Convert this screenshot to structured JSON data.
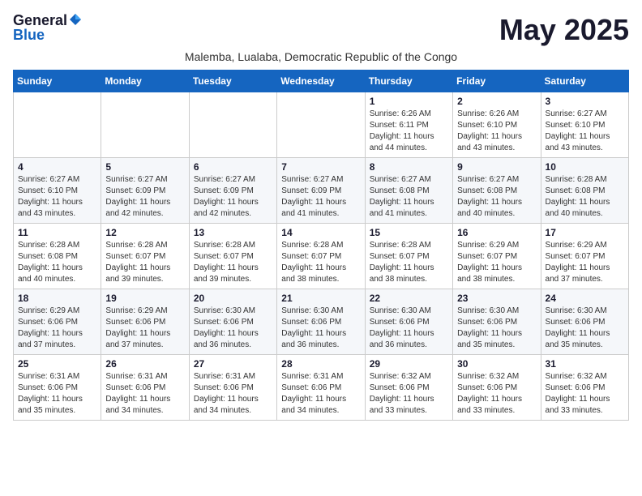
{
  "logo": {
    "general": "General",
    "blue": "Blue"
  },
  "title": "May 2025",
  "subtitle": "Malemba, Lualaba, Democratic Republic of the Congo",
  "weekdays": [
    "Sunday",
    "Monday",
    "Tuesday",
    "Wednesday",
    "Thursday",
    "Friday",
    "Saturday"
  ],
  "weeks": [
    [
      {
        "day": "",
        "info": ""
      },
      {
        "day": "",
        "info": ""
      },
      {
        "day": "",
        "info": ""
      },
      {
        "day": "",
        "info": ""
      },
      {
        "day": "1",
        "info": "Sunrise: 6:26 AM\nSunset: 6:11 PM\nDaylight: 11 hours and 44 minutes."
      },
      {
        "day": "2",
        "info": "Sunrise: 6:26 AM\nSunset: 6:10 PM\nDaylight: 11 hours and 43 minutes."
      },
      {
        "day": "3",
        "info": "Sunrise: 6:27 AM\nSunset: 6:10 PM\nDaylight: 11 hours and 43 minutes."
      }
    ],
    [
      {
        "day": "4",
        "info": "Sunrise: 6:27 AM\nSunset: 6:10 PM\nDaylight: 11 hours and 43 minutes."
      },
      {
        "day": "5",
        "info": "Sunrise: 6:27 AM\nSunset: 6:09 PM\nDaylight: 11 hours and 42 minutes."
      },
      {
        "day": "6",
        "info": "Sunrise: 6:27 AM\nSunset: 6:09 PM\nDaylight: 11 hours and 42 minutes."
      },
      {
        "day": "7",
        "info": "Sunrise: 6:27 AM\nSunset: 6:09 PM\nDaylight: 11 hours and 41 minutes."
      },
      {
        "day": "8",
        "info": "Sunrise: 6:27 AM\nSunset: 6:08 PM\nDaylight: 11 hours and 41 minutes."
      },
      {
        "day": "9",
        "info": "Sunrise: 6:27 AM\nSunset: 6:08 PM\nDaylight: 11 hours and 40 minutes."
      },
      {
        "day": "10",
        "info": "Sunrise: 6:28 AM\nSunset: 6:08 PM\nDaylight: 11 hours and 40 minutes."
      }
    ],
    [
      {
        "day": "11",
        "info": "Sunrise: 6:28 AM\nSunset: 6:08 PM\nDaylight: 11 hours and 40 minutes."
      },
      {
        "day": "12",
        "info": "Sunrise: 6:28 AM\nSunset: 6:07 PM\nDaylight: 11 hours and 39 minutes."
      },
      {
        "day": "13",
        "info": "Sunrise: 6:28 AM\nSunset: 6:07 PM\nDaylight: 11 hours and 39 minutes."
      },
      {
        "day": "14",
        "info": "Sunrise: 6:28 AM\nSunset: 6:07 PM\nDaylight: 11 hours and 38 minutes."
      },
      {
        "day": "15",
        "info": "Sunrise: 6:28 AM\nSunset: 6:07 PM\nDaylight: 11 hours and 38 minutes."
      },
      {
        "day": "16",
        "info": "Sunrise: 6:29 AM\nSunset: 6:07 PM\nDaylight: 11 hours and 38 minutes."
      },
      {
        "day": "17",
        "info": "Sunrise: 6:29 AM\nSunset: 6:07 PM\nDaylight: 11 hours and 37 minutes."
      }
    ],
    [
      {
        "day": "18",
        "info": "Sunrise: 6:29 AM\nSunset: 6:06 PM\nDaylight: 11 hours and 37 minutes."
      },
      {
        "day": "19",
        "info": "Sunrise: 6:29 AM\nSunset: 6:06 PM\nDaylight: 11 hours and 37 minutes."
      },
      {
        "day": "20",
        "info": "Sunrise: 6:30 AM\nSunset: 6:06 PM\nDaylight: 11 hours and 36 minutes."
      },
      {
        "day": "21",
        "info": "Sunrise: 6:30 AM\nSunset: 6:06 PM\nDaylight: 11 hours and 36 minutes."
      },
      {
        "day": "22",
        "info": "Sunrise: 6:30 AM\nSunset: 6:06 PM\nDaylight: 11 hours and 36 minutes."
      },
      {
        "day": "23",
        "info": "Sunrise: 6:30 AM\nSunset: 6:06 PM\nDaylight: 11 hours and 35 minutes."
      },
      {
        "day": "24",
        "info": "Sunrise: 6:30 AM\nSunset: 6:06 PM\nDaylight: 11 hours and 35 minutes."
      }
    ],
    [
      {
        "day": "25",
        "info": "Sunrise: 6:31 AM\nSunset: 6:06 PM\nDaylight: 11 hours and 35 minutes."
      },
      {
        "day": "26",
        "info": "Sunrise: 6:31 AM\nSunset: 6:06 PM\nDaylight: 11 hours and 34 minutes."
      },
      {
        "day": "27",
        "info": "Sunrise: 6:31 AM\nSunset: 6:06 PM\nDaylight: 11 hours and 34 minutes."
      },
      {
        "day": "28",
        "info": "Sunrise: 6:31 AM\nSunset: 6:06 PM\nDaylight: 11 hours and 34 minutes."
      },
      {
        "day": "29",
        "info": "Sunrise: 6:32 AM\nSunset: 6:06 PM\nDaylight: 11 hours and 33 minutes."
      },
      {
        "day": "30",
        "info": "Sunrise: 6:32 AM\nSunset: 6:06 PM\nDaylight: 11 hours and 33 minutes."
      },
      {
        "day": "31",
        "info": "Sunrise: 6:32 AM\nSunset: 6:06 PM\nDaylight: 11 hours and 33 minutes."
      }
    ]
  ]
}
